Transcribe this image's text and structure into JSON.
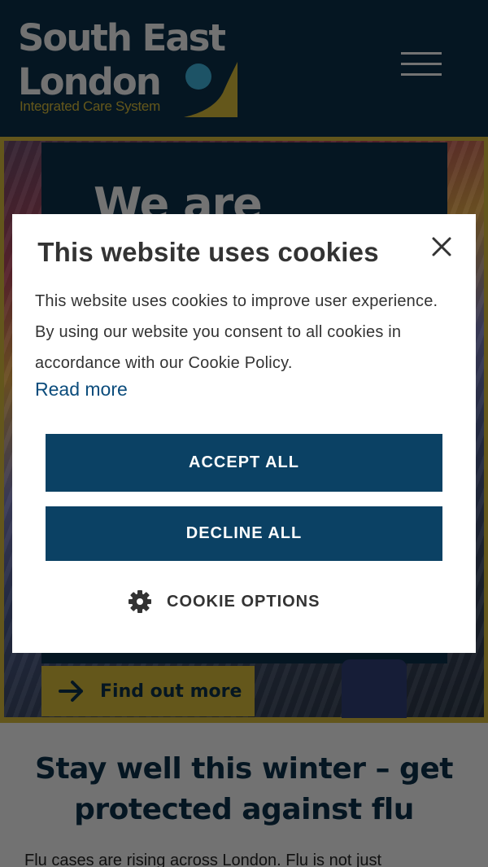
{
  "header": {
    "logo": {
      "line1": "South East",
      "line2": "London",
      "tagline": "Integrated Care System"
    },
    "menu_icon": "hamburger-menu-icon",
    "colors": {
      "navy": "#0b2d44",
      "gold": "#c8ae36"
    }
  },
  "hero": {
    "heading": "We are",
    "cta_label": "Find out more",
    "cta_icon": "arrow-right-icon"
  },
  "content": {
    "title": "Stay well this winter – get protected against flu",
    "body": "Flu cases are rising across London. Flu is not just"
  },
  "cookie_dialog": {
    "title": "This website uses cookies",
    "close_icon": "close-icon",
    "text": "This website uses cookies to improve user experience. By using our website you consent to all cookies in accordance with our Cookie Policy.",
    "read_more": "Read more",
    "accept_label": "ACCEPT ALL",
    "decline_label": "DECLINE ALL",
    "options_label": "COOKIE OPTIONS",
    "options_icon": "gear-icon",
    "button_color": "#0b4164"
  }
}
